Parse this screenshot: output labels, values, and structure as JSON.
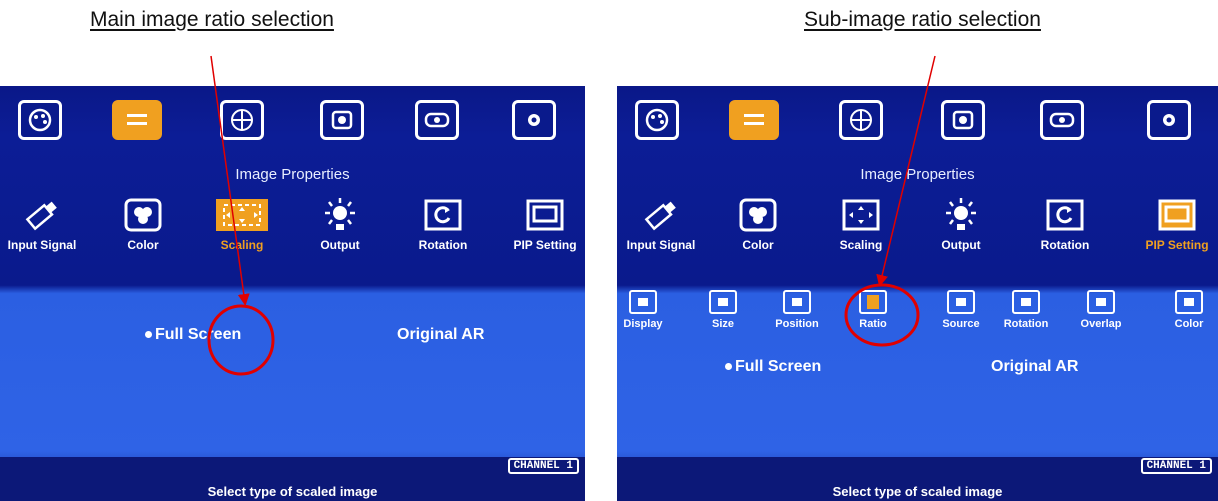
{
  "left": {
    "caption": "Main image ratio selection",
    "top_icons": [
      "palette-icon",
      "scaling-menu-icon",
      "globe-icon",
      "cube-icon",
      "projector-icon",
      "settings-gear-icon"
    ],
    "selected_top": 1,
    "section_title": "Image Properties",
    "menu": [
      {
        "label": "Input Signal",
        "icon": "usb-icon"
      },
      {
        "label": "Color",
        "icon": "color-icon"
      },
      {
        "label": "Scaling",
        "icon": "scaling-icon"
      },
      {
        "label": "Output",
        "icon": "output-icon"
      },
      {
        "label": "Rotation",
        "icon": "rotation-icon"
      },
      {
        "label": "PIP Setting",
        "icon": "pip-icon"
      }
    ],
    "selected_menu": "Scaling",
    "option_selected": "Full Screen",
    "option_other": "Original AR",
    "channel": "CHANNEL 1",
    "status": "Select type of scaled image"
  },
  "right": {
    "caption": "Sub-image ratio selection",
    "section_title": "Image Properties",
    "menu": [
      {
        "label": "Input Signal"
      },
      {
        "label": "Color"
      },
      {
        "label": "Scaling"
      },
      {
        "label": "Output"
      },
      {
        "label": "Rotation"
      },
      {
        "label": "PIP Setting"
      }
    ],
    "selected_menu": "PIP Setting",
    "submenu": [
      {
        "label": "Display"
      },
      {
        "label": "Size"
      },
      {
        "label": "Position"
      },
      {
        "label": "Ratio"
      },
      {
        "label": "Source"
      },
      {
        "label": "Rotation"
      },
      {
        "label": "Overlap"
      },
      {
        "label": "Color"
      }
    ],
    "selected_submenu": "Ratio",
    "option_selected": "Full Screen",
    "option_other": "Original AR",
    "channel": "CHANNEL 1",
    "status": "Select type of scaled image"
  },
  "colors": {
    "highlight": "#f0a020",
    "annotation": "#e00000",
    "menu_bg": "#0a1a8c",
    "panel_bg": "#2f63e6"
  }
}
